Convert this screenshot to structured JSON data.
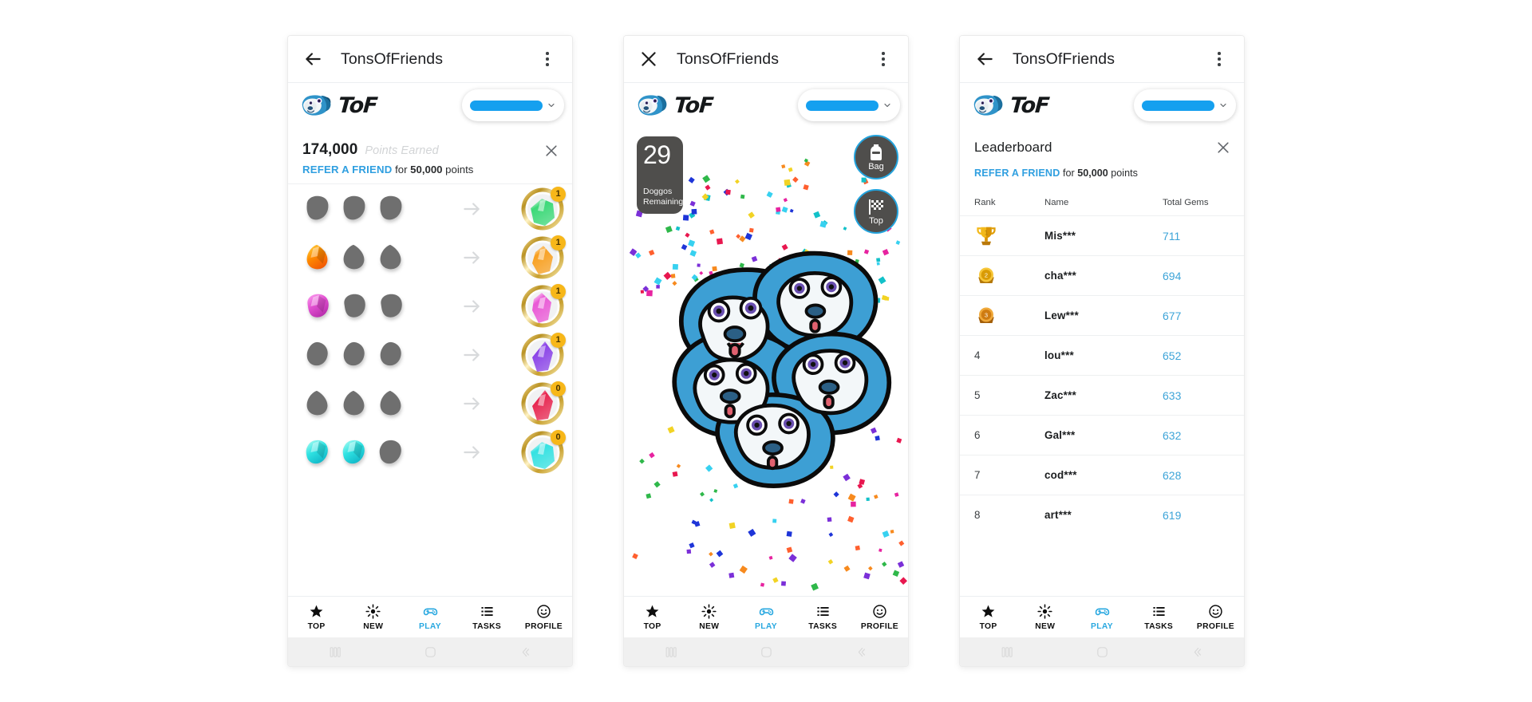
{
  "app": {
    "title": "TonsOfFriends",
    "brand_word": "ToF",
    "logo_icon": "pug-dog-logo",
    "accent_blue": "#29a8e0",
    "gold": "#f7b719"
  },
  "panels": [
    {
      "id": "craft",
      "appbar": {
        "nav_icon": "back-arrow-icon",
        "title": "TonsOfFriends",
        "overflow_icon": "more-vertical-icon"
      },
      "account_pill": {
        "redacted": true,
        "chevron_icon": "chevron-down-icon"
      },
      "points": {
        "value": "174,000",
        "label": "Points Earned",
        "close_icon": "close-icon",
        "refer_link": "REFER A FRIEND",
        "refer_mid": " for ",
        "refer_amount": "50,000",
        "refer_tail": " points"
      },
      "craft_rows": [
        {
          "rocks": [
            "locked",
            "locked",
            "locked"
          ],
          "gem_color": "#3bd977",
          "count": "1",
          "shape": "chunk"
        },
        {
          "rocks": [
            "fire",
            "locked",
            "locked"
          ],
          "gem_color": "#f9a020",
          "count": "1",
          "shape": "drop"
        },
        {
          "rocks": [
            "pink",
            "locked",
            "locked"
          ],
          "gem_color": "#ea58d6",
          "count": "1",
          "shape": "crystal"
        },
        {
          "rocks": [
            "locked",
            "locked",
            "locked"
          ],
          "gem_color": "#8a42e8",
          "count": "1",
          "shape": "shard"
        },
        {
          "rocks": [
            "locked",
            "locked",
            "locked"
          ],
          "gem_color": "#e8254f",
          "count": "0",
          "shape": "shard"
        },
        {
          "rocks": [
            "cyan",
            "cyan",
            "locked"
          ],
          "gem_color": "#34e2e2",
          "count": "0",
          "shape": "chunk"
        }
      ]
    },
    {
      "id": "play",
      "appbar": {
        "nav_icon": "close-icon",
        "title": "TonsOfFriends",
        "overflow_icon": "more-vertical-icon"
      },
      "account_pill": {
        "redacted": true,
        "chevron_icon": "chevron-down-icon"
      },
      "counter": {
        "number": "29",
        "caption_line1": "Doggos",
        "caption_line2": "Remaining"
      },
      "side_buttons": [
        {
          "label": "Bag",
          "icon": "backpack-icon"
        },
        {
          "label": "Top",
          "icon": "checkered-flag-icon"
        }
      ]
    },
    {
      "id": "leaderboard",
      "appbar": {
        "nav_icon": "back-arrow-icon",
        "title": "TonsOfFriends",
        "overflow_icon": "more-vertical-icon"
      },
      "account_pill": {
        "redacted": true,
        "chevron_icon": "chevron-down-icon"
      },
      "leaderboard": {
        "title": "Leaderboard",
        "close_icon": "close-icon",
        "refer_link": "REFER A FRIEND",
        "refer_mid": " for ",
        "refer_amount": "50,000",
        "refer_tail": " points",
        "columns": [
          "Rank",
          "Name",
          "Total Gems"
        ],
        "rows": [
          {
            "rank": "1",
            "medal": "trophy-gold",
            "name": "Mis***",
            "gems": "711"
          },
          {
            "rank": "2",
            "medal": "medal-silver",
            "name": "cha***",
            "gems": "694"
          },
          {
            "rank": "3",
            "medal": "medal-bronze",
            "name": "Lew***",
            "gems": "677"
          },
          {
            "rank": "4",
            "medal": "",
            "name": "lou***",
            "gems": "652"
          },
          {
            "rank": "5",
            "medal": "",
            "name": "Zac***",
            "gems": "633"
          },
          {
            "rank": "6",
            "medal": "",
            "name": "Gal***",
            "gems": "632"
          },
          {
            "rank": "7",
            "medal": "",
            "name": "cod***",
            "gems": "628"
          },
          {
            "rank": "8",
            "medal": "",
            "name": "art***",
            "gems": "619"
          }
        ]
      }
    }
  ],
  "bottom_nav": {
    "items": [
      {
        "label": "TOP",
        "icon": "star-icon",
        "active": false
      },
      {
        "label": "NEW",
        "icon": "sparkle-icon",
        "active": false
      },
      {
        "label": "PLAY",
        "icon": "gamepad-icon",
        "active": true
      },
      {
        "label": "TASKS",
        "icon": "list-icon",
        "active": false
      },
      {
        "label": "PROFILE",
        "icon": "smiley-icon",
        "active": false
      }
    ]
  },
  "system_bar": {
    "buttons": [
      {
        "icon": "recents-icon"
      },
      {
        "icon": "home-icon"
      },
      {
        "icon": "back-icon"
      }
    ]
  }
}
